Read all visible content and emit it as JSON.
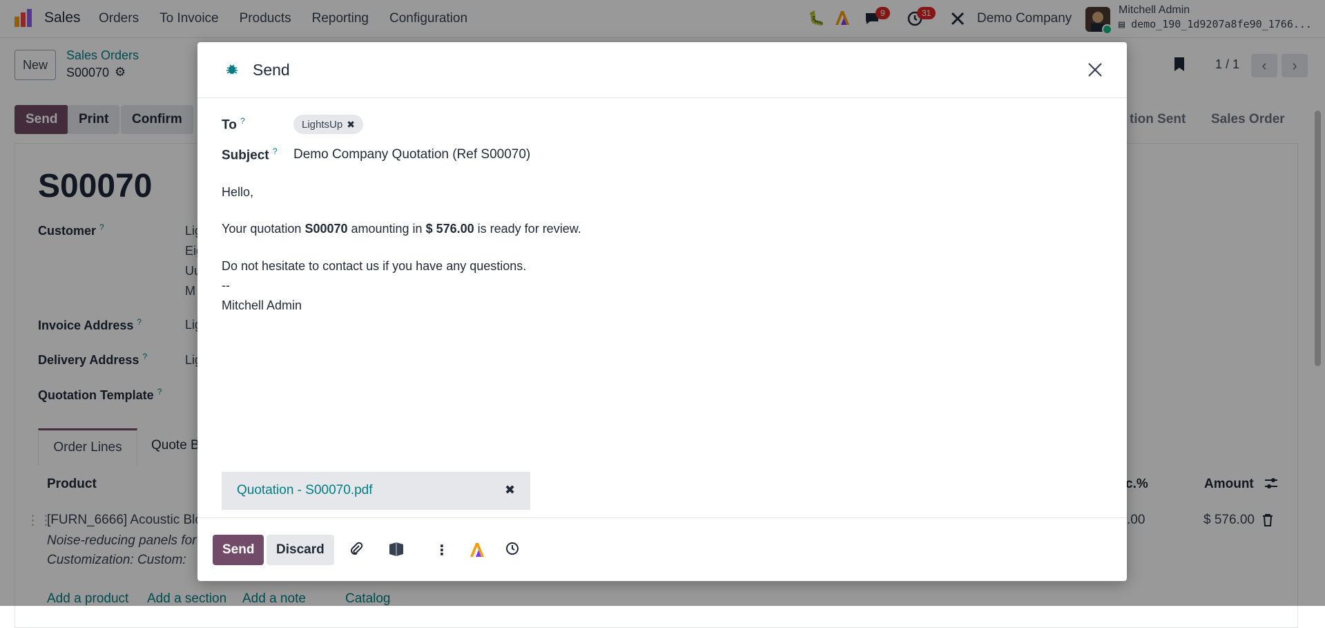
{
  "app": {
    "name": "Sales",
    "menu": [
      "Orders",
      "To Invoice",
      "Products",
      "Reporting",
      "Configuration"
    ],
    "notifications": {
      "messages": "9",
      "activities": "31"
    },
    "company": "Demo Company",
    "user": {
      "name": "Mitchell Admin",
      "database": "demo_190_1d9207a8fe90_1766..."
    }
  },
  "control_panel": {
    "new_label": "New",
    "breadcrumb_parent": "Sales Orders",
    "breadcrumb_current": "S00070",
    "pager": "1 / 1"
  },
  "status_bar": {
    "buttons": [
      "Send",
      "Print",
      "Confirm"
    ],
    "stages": [
      "tion Sent",
      "Sales Order"
    ]
  },
  "form": {
    "name": "S00070",
    "labels": {
      "customer": "Customer",
      "invoice_address": "Invoice Address",
      "delivery_address": "Delivery Address",
      "quotation_template": "Quotation Template",
      "help_mark": "?"
    },
    "customer_lines": [
      "Lig",
      "Eig",
      "Uu",
      "M"
    ],
    "invoice_address_value": "Lig",
    "delivery_address_value": "Lig",
    "tabs": [
      "Order Lines",
      "Quote B"
    ],
    "table": {
      "headers": {
        "product": "Product",
        "disc": "c.%",
        "amount": "Amount"
      },
      "row": {
        "product": "[FURN_6666] Acoustic Blo",
        "description": "Noise-reducing panels for",
        "customization": "Customization: Custom:",
        "disc": ".00",
        "amount": "$ 576.00"
      }
    },
    "add_links": [
      "Add a product",
      "Add a section",
      "Add a note",
      "Catalog"
    ]
  },
  "modal": {
    "title": "Send",
    "to_label": "To",
    "subject_label": "Subject",
    "help_mark": "?",
    "recipients": [
      "LightsUp"
    ],
    "subject": "Demo Company Quotation (Ref S00070)",
    "body": {
      "greeting": "Hello,",
      "line_prefix": "Your quotation ",
      "order_ref": "S00070",
      "line_middle": " amounting in ",
      "amount": "$ 576.00",
      "line_suffix": " is ready for review.",
      "contact_line": "Do not hesitate to contact us if you have any questions.",
      "separator": "--",
      "signature": "Mitchell Admin"
    },
    "attachment": "Quotation - S00070.pdf",
    "footer": {
      "send_label": "Send",
      "discard_label": "Discard"
    }
  },
  "colors": {
    "primary": "#714b67",
    "link": "#017e84",
    "badge": "#dc2626"
  }
}
